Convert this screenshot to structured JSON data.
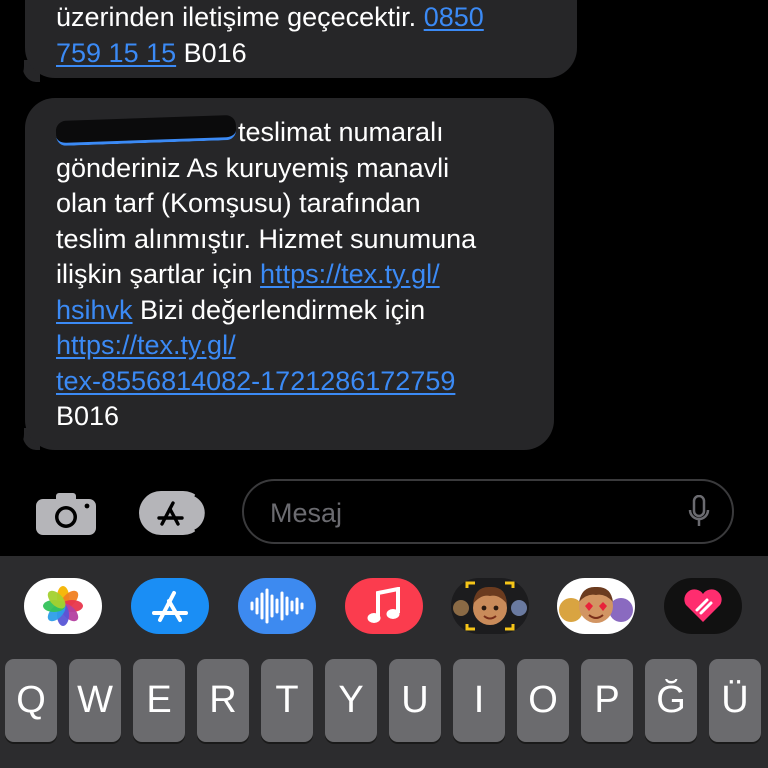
{
  "messages": [
    {
      "lines": [
        {
          "text": "üzerinden iletişime geçecektir. ",
          "link": "0850"
        },
        {
          "link": "759 15 15",
          "text": " B016"
        }
      ]
    },
    {
      "lines": [
        {
          "text": "teslimat numaralı"
        },
        {
          "text": "gönderiniz As kuruyemiş manavli"
        },
        {
          "text": "olan tarf (Komşusu)  tarafından"
        },
        {
          "text": "teslim alınmıştır. Hizmet sunumuna"
        },
        {
          "text": "ilişkin şartlar için ",
          "link": "https://tex.ty.gl/"
        },
        {
          "link": "hsihvk",
          "text": " Bizi değerlendirmek için"
        },
        {
          "link": "https://tex.ty.gl/"
        },
        {
          "link": "tex-8556814082-1721286172759"
        },
        {
          "text": "B016"
        }
      ]
    }
  ],
  "input_bar": {
    "placeholder": "Mesaj",
    "camera_icon": "camera-icon",
    "apps_icon": "app-store-icon",
    "mic_icon": "microphone-icon"
  },
  "app_drawer": [
    {
      "name": "photos-app-icon",
      "bg": "#ffffff"
    },
    {
      "name": "app-store-app-icon",
      "bg": "#1a8ef5"
    },
    {
      "name": "audio-message-app-icon",
      "bg": "#3d8af0"
    },
    {
      "name": "music-app-icon",
      "bg": "#fb3c4e"
    },
    {
      "name": "memoji-app-icon",
      "bg": "#1c1c1e"
    },
    {
      "name": "memoji-stickers-app-icon",
      "bg": "#ffffff"
    },
    {
      "name": "digital-touch-app-icon",
      "bg": "#111111"
    }
  ],
  "keyboard": {
    "row1": [
      "Q",
      "W",
      "E",
      "R",
      "T",
      "Y",
      "U",
      "I",
      "O",
      "P",
      "Ğ",
      "Ü"
    ]
  },
  "colors": {
    "bubble": "#262628",
    "link": "#3b8af5",
    "keyboard": "#2c2c2e",
    "key": "#6b6b6e"
  }
}
